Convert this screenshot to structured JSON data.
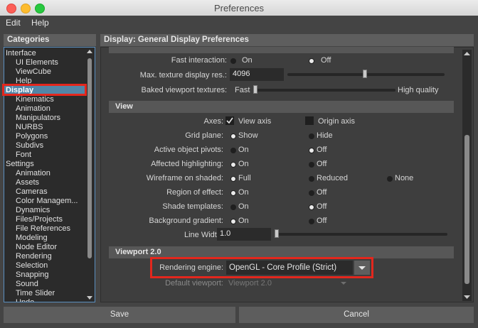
{
  "window": {
    "title": "Preferences"
  },
  "menu": {
    "edit": "Edit",
    "help": "Help"
  },
  "left": {
    "header": "Categories",
    "items": [
      {
        "label": "Interface",
        "indent": 0
      },
      {
        "label": "UI Elements",
        "indent": 1
      },
      {
        "label": "ViewCube",
        "indent": 1
      },
      {
        "label": "Help",
        "indent": 1
      },
      {
        "label": "Display",
        "indent": 0,
        "selected": true
      },
      {
        "label": "Kinematics",
        "indent": 1
      },
      {
        "label": "Animation",
        "indent": 1
      },
      {
        "label": "Manipulators",
        "indent": 1
      },
      {
        "label": "NURBS",
        "indent": 1
      },
      {
        "label": "Polygons",
        "indent": 1
      },
      {
        "label": "Subdivs",
        "indent": 1
      },
      {
        "label": "Font",
        "indent": 1
      },
      {
        "label": "Settings",
        "indent": 0
      },
      {
        "label": "Animation",
        "indent": 1
      },
      {
        "label": "Assets",
        "indent": 1
      },
      {
        "label": "Cameras",
        "indent": 1
      },
      {
        "label": "Color Managem...",
        "indent": 1
      },
      {
        "label": "Dynamics",
        "indent": 1
      },
      {
        "label": "Files/Projects",
        "indent": 1
      },
      {
        "label": "File References",
        "indent": 1
      },
      {
        "label": "Modeling",
        "indent": 1
      },
      {
        "label": "Node Editor",
        "indent": 1
      },
      {
        "label": "Rendering",
        "indent": 1
      },
      {
        "label": "Selection",
        "indent": 1
      },
      {
        "label": "Snapping",
        "indent": 1
      },
      {
        "label": "Sound",
        "indent": 1
      },
      {
        "label": "Time Slider",
        "indent": 1
      },
      {
        "label": "Undo",
        "indent": 1
      }
    ]
  },
  "right": {
    "header": "Display: General Display Preferences",
    "fast_interaction": {
      "label": "Fast interaction:",
      "on": "On",
      "off": "Off",
      "value": "Off"
    },
    "max_texture": {
      "label": "Max. texture display res.:",
      "value": "4096",
      "slider_fraction": 0.5
    },
    "baked_textures": {
      "label": "Baked viewport textures:",
      "min": "Fast",
      "max": "High quality",
      "slider_fraction": 0.0
    },
    "view_section": "View",
    "axes": {
      "label": "Axes:",
      "view_axis": "View axis",
      "origin_axis": "Origin axis",
      "view_axis_checked": true,
      "origin_axis_checked": false
    },
    "grid_plane": {
      "label": "Grid plane:",
      "show": "Show",
      "hide": "Hide",
      "value": "Show"
    },
    "active_object_pivots": {
      "label": "Active object pivots:",
      "on": "On",
      "off": "Off",
      "value": "Off"
    },
    "affected_highlighting": {
      "label": "Affected highlighting:",
      "on": "On",
      "off": "Off",
      "value": "On"
    },
    "wireframe_on_shaded": {
      "label": "Wireframe on shaded:",
      "full": "Full",
      "reduced": "Reduced",
      "none": "None",
      "value": "Full"
    },
    "region_of_effect": {
      "label": "Region of effect:",
      "on": "On",
      "off": "Off",
      "value": "On"
    },
    "shade_templates": {
      "label": "Shade templates:",
      "on": "On",
      "off": "Off",
      "value": "Off"
    },
    "background_gradient": {
      "label": "Background gradient:",
      "on": "On",
      "off": "Off",
      "value": "On"
    },
    "line_width": {
      "label": "Line Width:",
      "value": "1.0",
      "slider_fraction": 0.0
    },
    "viewport_section": "Viewport 2.0",
    "rendering_engine": {
      "label": "Rendering engine:",
      "value": "OpenGL - Core Profile (Strict)"
    },
    "default_viewport": {
      "label": "Default viewport:",
      "value": "Viewport 2.0"
    }
  },
  "buttons": {
    "save": "Save",
    "cancel": "Cancel"
  },
  "colors": {
    "highlight": "#e3271d",
    "selection": "#5285a6"
  }
}
